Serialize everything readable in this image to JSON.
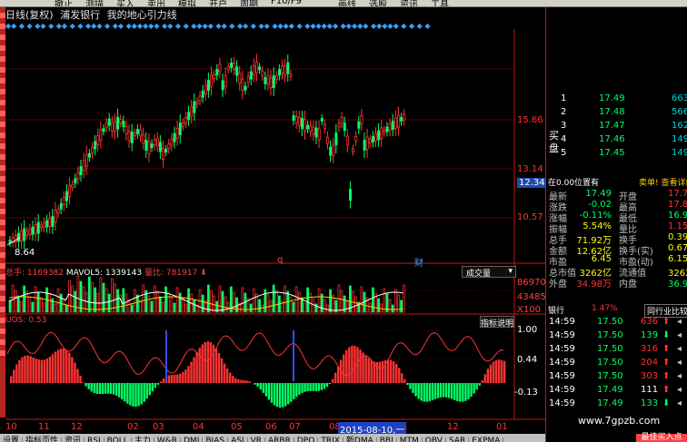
{
  "toolbar": {
    "items": [
      "撤止",
      "测描",
      "买入",
      "卖出",
      "模拟",
      "开户",
      "周期",
      "F10/F9",
      "画线",
      "选股",
      "资讯",
      "工具"
    ]
  },
  "title": {
    "period": "日线(复权)",
    "stock": "浦发银行",
    "indicator": "我的地心引力线"
  },
  "price_axis": {
    "labels": [
      "15.66",
      "13.14",
      "12.34",
      "10.57"
    ],
    "current": "12.34",
    "low_label": "8.64"
  },
  "markers": {
    "q": "q",
    "cai": "财"
  },
  "volume": {
    "total_label": "总手:",
    "total_value": "1169382",
    "mavol_label": "MAVOL5:",
    "mavol_value": "1339143",
    "ratio_label": "量比:",
    "ratio_value": "781917",
    "selector": "成交量",
    "axis": [
      "86970",
      "43485",
      "X100"
    ]
  },
  "indicator_panel": {
    "label": "UOS: 0.53",
    "button": "指标说明",
    "axis": [
      "1.00",
      "0.44",
      "-0.13"
    ]
  },
  "months": [
    {
      "label": "10"
    },
    {
      "label": "11"
    },
    {
      "label": "12"
    },
    {
      "label": "02"
    },
    {
      "label": "03"
    },
    {
      "label": "04"
    },
    {
      "label": "05"
    },
    {
      "label": "06"
    },
    {
      "label": "07"
    },
    {
      "label": "08"
    },
    {
      "label": "09"
    },
    {
      "label": "11"
    },
    {
      "label": "12"
    },
    {
      "label": "01"
    }
  ],
  "month_highlight": "2015-08-10,一",
  "bottom_tabs": [
    "设置",
    "指标页性",
    "资讯",
    "RSI",
    "BOLL",
    "主力",
    "W&R",
    "DMI",
    "BIAS",
    "ASI",
    "VR",
    "ARBR",
    "DPO",
    "TRIX",
    "新DMA",
    "BBI",
    "MTM",
    "OBV",
    "SAR",
    "EXPMA"
  ],
  "buy_button": "最佳买入点",
  "order_book": {
    "side_label": "买盘",
    "rows": [
      {
        "lvl": "1",
        "px": "17.49",
        "vol": "663"
      },
      {
        "lvl": "2",
        "px": "17.48",
        "vol": "566"
      },
      {
        "lvl": "3",
        "px": "17.47",
        "vol": "162"
      },
      {
        "lvl": "4",
        "px": "17.46",
        "vol": "149"
      },
      {
        "lvl": "5",
        "px": "17.45",
        "vol": "149"
      }
    ]
  },
  "position_bar": {
    "left": "在0.00位置有",
    "right": "卖单! 查看详细"
  },
  "stats": [
    {
      "k1": "最新",
      "v1": "17.49",
      "c1": "green",
      "k2": "开盘",
      "v2": "17.74",
      "c2": "red"
    },
    {
      "k1": "涨跌",
      "v1": "-0.02",
      "c1": "green",
      "k2": "最高",
      "v2": "17.86",
      "c2": "red"
    },
    {
      "k1": "涨幅",
      "v1": "-0.11%",
      "c1": "green",
      "k2": "最低",
      "v2": "16.91",
      "c2": "green"
    },
    {
      "k1": "振幅",
      "v1": "5.54%",
      "c1": "yellow",
      "k2": "量比",
      "v2": "1.15",
      "c2": "red"
    },
    {
      "k1": "总手",
      "v1": "71.92万",
      "c1": "yellow",
      "k2": "换手",
      "v2": "0.39%",
      "c2": "yellow"
    },
    {
      "k1": "金额",
      "v1": "12.62亿",
      "c1": "yellow",
      "k2": "换手(实)",
      "v2": "0.67%",
      "c2": "yellow"
    },
    {
      "k1": "市盈",
      "v1": "6.45",
      "c1": "yellow",
      "k2": "市盈(动)",
      "v2": "6.15",
      "c2": "yellow"
    },
    {
      "k1": "总市值",
      "v1": "3262亿",
      "c1": "yellow",
      "k2": "流通值",
      "v2": "3262亿",
      "c2": "yellow"
    },
    {
      "k1": "外盘",
      "v1": "34.98万",
      "c1": "red",
      "k2": "内盘",
      "v2": "36.94万",
      "c2": "green"
    }
  ],
  "sector": {
    "name": "银行",
    "pct": "1.47%",
    "button": "同行业比较"
  },
  "ticks": [
    {
      "t": "14:59",
      "p": "17.50",
      "pc": "green",
      "q": "636",
      "qc": "red",
      "arr": "up"
    },
    {
      "t": "14:59",
      "p": "17.50",
      "pc": "green",
      "q": "139",
      "qc": "green",
      "arr": "down"
    },
    {
      "t": "14:59",
      "p": "17.50",
      "pc": "green",
      "q": "316",
      "qc": "red",
      "arr": "up"
    },
    {
      "t": "14:59",
      "p": "17.50",
      "pc": "green",
      "q": "204",
      "qc": "red",
      "arr": "up"
    },
    {
      "t": "14:59",
      "p": "17.50",
      "pc": "green",
      "q": "303",
      "qc": "red",
      "arr": "up"
    },
    {
      "t": "14:59",
      "p": "17.49",
      "pc": "green",
      "q": "111",
      "qc": "white",
      "arr": "up"
    },
    {
      "t": "14:59",
      "p": "17.49",
      "pc": "green",
      "q": "133",
      "qc": "green",
      "arr": "down"
    }
  ],
  "watermark": "www.7gpzb.com",
  "colors": {
    "up": "#ff3333",
    "down": "#00ff66",
    "accent": "#3aa0ff",
    "frame": "#c01818"
  }
}
